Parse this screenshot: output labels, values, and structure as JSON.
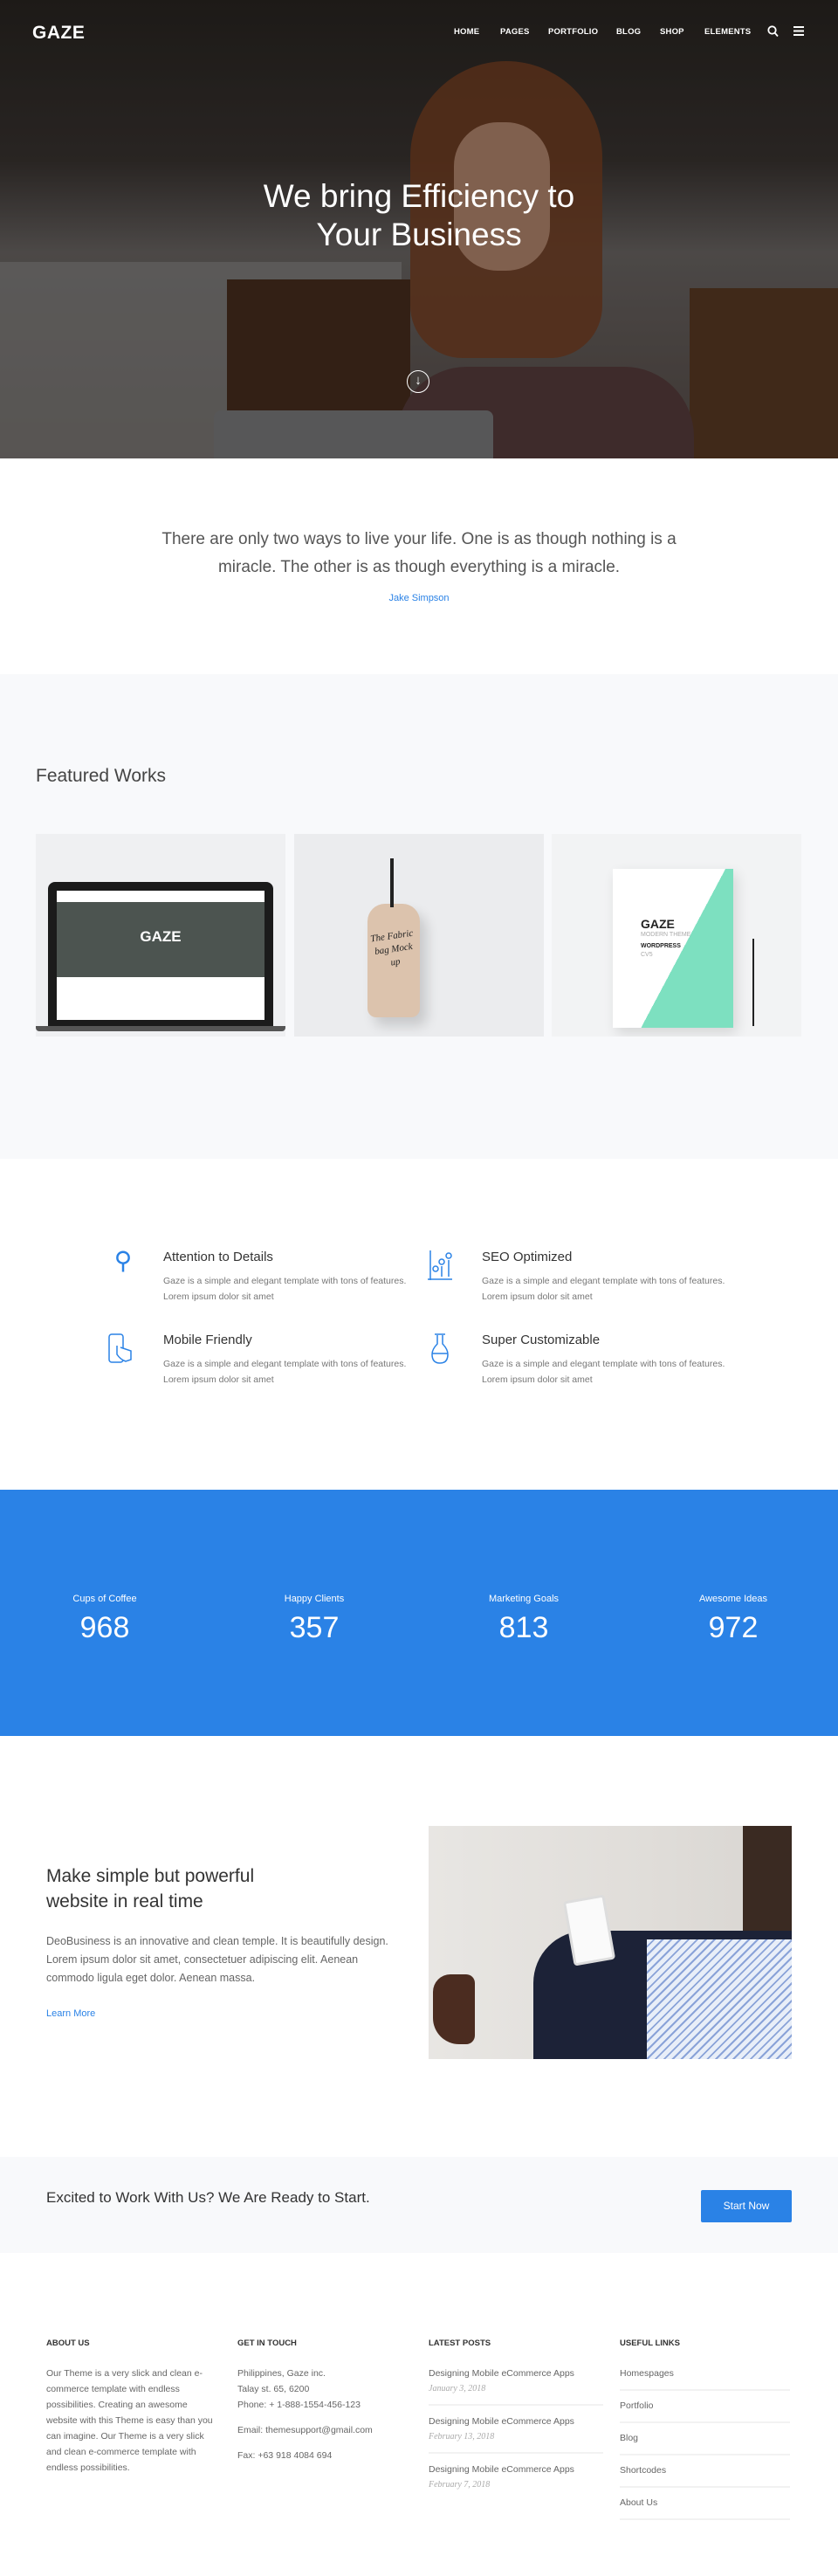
{
  "header": {
    "logo": "GAZE",
    "nav": [
      "HOME",
      "PAGES",
      "PORTFOLIO",
      "BLOG",
      "SHOP",
      "ELEMENTS"
    ],
    "icons": [
      "search-icon",
      "menu-icon"
    ]
  },
  "hero": {
    "title_line1": "We bring Efficiency to",
    "title_line2": "Your Business",
    "scroll_icon": "arrow-down-circle-icon"
  },
  "quote": {
    "text": "There are only two ways to live your life. One is as though nothing is a miracle. The other is as though everything is a miracle.",
    "author": "Jake Simpson"
  },
  "featured": {
    "title": "Featured Works",
    "works": [
      {
        "label": "GAZE"
      },
      {
        "label": "The Fabric bag Mock up"
      },
      {
        "label": "GAZE",
        "sub": "MODERN THEME",
        "sub2": "WORDPRESS",
        "sub3": "CV5"
      }
    ]
  },
  "features": [
    {
      "icon": "desk-lamp-icon",
      "title": "Attention to Details",
      "text": "Gaze is a simple and elegant template with tons of features. Lorem ipsum dolor sit amet"
    },
    {
      "icon": "chart-icon",
      "title": "SEO Optimized",
      "text": "Gaze is a simple and elegant template with tons of features. Lorem ipsum dolor sit amet"
    },
    {
      "icon": "mobile-touch-icon",
      "title": "Mobile Friendly",
      "text": "Gaze is a simple and elegant template with tons of features. Lorem ipsum dolor sit amet"
    },
    {
      "icon": "flask-icon",
      "title": "Super Customizable",
      "text": "Gaze is a simple and elegant template with tons of features. Lorem ipsum dolor sit amet"
    }
  ],
  "stats": [
    {
      "label": "Cups of Coffee",
      "value": "968"
    },
    {
      "label": "Happy Clients",
      "value": "357"
    },
    {
      "label": "Marketing Goals",
      "value": "813"
    },
    {
      "label": "Awesome Ideas",
      "value": "972"
    }
  ],
  "about": {
    "title": "Make simple but powerful website in real time",
    "text": "DeoBusiness is an innovative and clean temple. It is beautifully design. Lorem ipsum dolor sit amet, consectetuer adipiscing elit. Aenean commodo ligula eget dolor. Aenean massa.",
    "link": "Learn More"
  },
  "cta": {
    "text": "Excited to Work With Us? We Are Ready to Start.",
    "button": "Start Now"
  },
  "footer": {
    "about": {
      "heading": "ABOUT US",
      "text": "Our Theme is a very slick and clean e-commerce template with endless possibilities. Creating an awesome website with this Theme is easy than you can imagine. Our Theme is a very slick and clean e-commerce template with endless possibilities."
    },
    "contact": {
      "heading": "GET IN TOUCH",
      "address1": "Philippines, Gaze inc.",
      "address2": "Talay st. 65, 6200",
      "phone": "Phone: + 1-888-1554-456-123",
      "email": "Email: themesupport@gmail.com",
      "fax": "Fax: +63 918 4084 694"
    },
    "posts": {
      "heading": "LATEST POSTS",
      "items": [
        {
          "title": "Designing Mobile eCommerce Apps",
          "date": "January 3, 2018"
        },
        {
          "title": "Designing Mobile eCommerce Apps",
          "date": "February 13, 2018"
        },
        {
          "title": "Designing Mobile eCommerce Apps",
          "date": "February 7, 2018"
        }
      ]
    },
    "links": {
      "heading": "USEFUL LINKS",
      "items": [
        "Homespages",
        "Portfolio",
        "Blog",
        "Shortcodes",
        "About Us"
      ]
    }
  },
  "colors": {
    "accent": "#2a82e6",
    "light_bg": "#f8f9fb"
  }
}
